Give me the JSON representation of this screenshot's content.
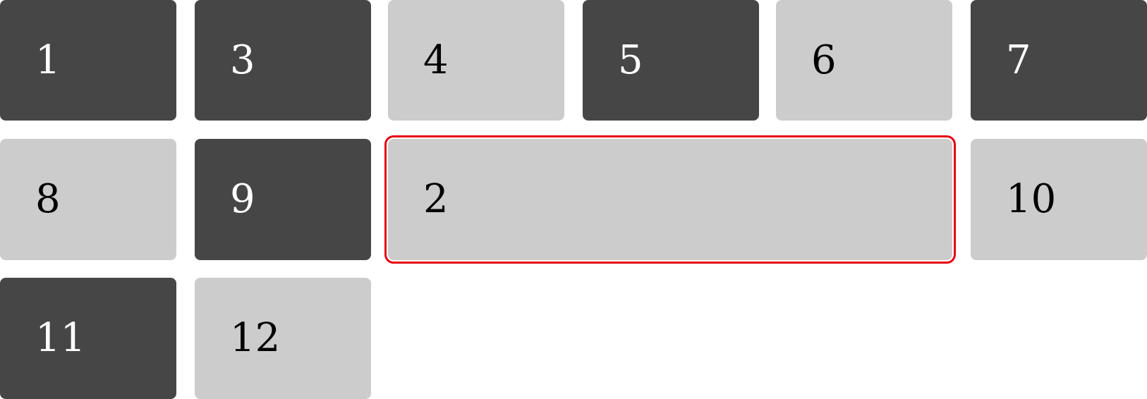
{
  "tiles": [
    {
      "label": "1",
      "tone": "dark"
    },
    {
      "label": "3",
      "tone": "dark"
    },
    {
      "label": "4",
      "tone": "light"
    },
    {
      "label": "5",
      "tone": "dark"
    },
    {
      "label": "6",
      "tone": "light"
    },
    {
      "label": "7",
      "tone": "dark"
    },
    {
      "label": "8",
      "tone": "light"
    },
    {
      "label": "9",
      "tone": "dark"
    },
    {
      "label": "2",
      "tone": "light",
      "selected": true
    },
    {
      "label": "10",
      "tone": "light"
    },
    {
      "label": "11",
      "tone": "dark"
    },
    {
      "label": "12",
      "tone": "light"
    }
  ],
  "colors": {
    "dark_tile": "#464646",
    "light_tile": "#cccccc",
    "selection_outline": "#e4000f",
    "background": "#ffffff"
  }
}
